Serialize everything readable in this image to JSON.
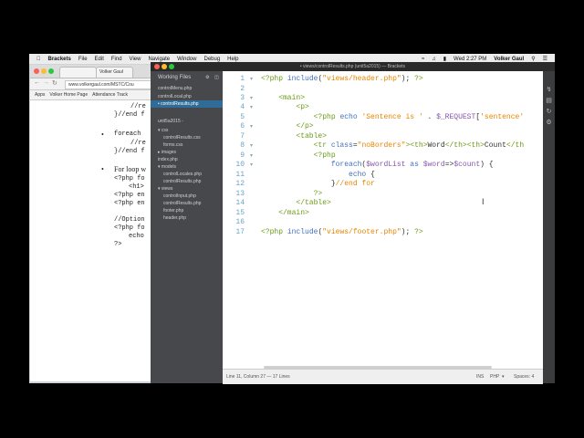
{
  "menubar": {
    "items": [
      "Brackets",
      "File",
      "Edit",
      "Find",
      "View",
      "Navigate",
      "Window",
      "Debug",
      "Help"
    ],
    "clock": "Wed 2:27 PM",
    "user": "Volker Gaul"
  },
  "browser": {
    "tab_label": "Volker Gaul",
    "url": "www.volkergaul.com/MSTC/Cou",
    "bookmarks": [
      "Apps",
      "Volker Home Page",
      "Attendance Track"
    ],
    "page_lines": [
      "//re",
      "}//end f",
      "foreach",
      "//re",
      "}//end f",
      "For loop w",
      "<?php fo",
      "<h1>",
      "<?php en",
      "<?php en",
      "//Option",
      "<?php fo",
      "echo",
      "?>"
    ]
  },
  "brackets": {
    "title": "• views/controlResults.php (unit5a2015) — Brackets",
    "sidebar": {
      "working_files_label": "Working Files",
      "working_files": [
        "controlMenu.php",
        "controlLocal.php",
        "• controlResults.php"
      ],
      "project_label": "unit5a2015 -",
      "tree": [
        {
          "label": "▾ css",
          "indent": 0
        },
        {
          "label": "controlResults.css",
          "indent": 2
        },
        {
          "label": "forms.css",
          "indent": 2
        },
        {
          "label": "▸ images",
          "indent": 0
        },
        {
          "label": "index.php",
          "indent": 0
        },
        {
          "label": "▾ models",
          "indent": 0
        },
        {
          "label": "controlLocales.php",
          "indent": 2
        },
        {
          "label": "controlResults.php",
          "indent": 2
        },
        {
          "label": "▾ views",
          "indent": 0
        },
        {
          "label": "controlInput.php",
          "indent": 2
        },
        {
          "label": "controlResults.php",
          "indent": 2
        },
        {
          "label": "footer.php",
          "indent": 2
        },
        {
          "label": "header.php",
          "indent": 2
        }
      ]
    },
    "line_numbers": [
      "1",
      "2",
      "3",
      "4",
      "5",
      "6",
      "7",
      "8",
      "9",
      "10",
      "11",
      "12",
      "13",
      "14",
      "15",
      "16",
      "17"
    ],
    "status": {
      "position": "Line 11, Column 27 — 17 Lines",
      "ins": "INS",
      "lang": "PHP",
      "spaces": "Spaces: 4"
    }
  }
}
